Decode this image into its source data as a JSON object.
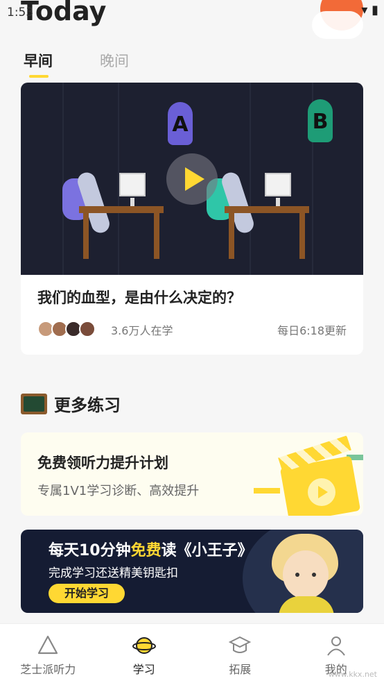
{
  "status": {
    "time": "1:53"
  },
  "header": {
    "title": "Today"
  },
  "tabs": [
    {
      "label": "早间",
      "active": true
    },
    {
      "label": "晚间",
      "active": false
    }
  ],
  "video": {
    "letter_a": "A",
    "letter_b": "B",
    "title": "我们的血型，是由什么决定的？",
    "learners": "3.6万人在学",
    "update": "每日6:18更新"
  },
  "section": {
    "title": "更多练习"
  },
  "promo": {
    "title": "免费领听力提升计划",
    "subtitle": "专属1V1学习诊断、高效提升"
  },
  "banner": {
    "title_prefix": "每天10分钟",
    "title_highlight": "免费",
    "title_suffix": "读《小王子》",
    "subtitle": "完成学习还送精美钥匙扣",
    "button": "开始学习"
  },
  "tabbar": [
    {
      "label": "芝士派听力",
      "icon": "cheese-icon"
    },
    {
      "label": "学习",
      "icon": "planet-icon",
      "active": true
    },
    {
      "label": "拓展",
      "icon": "graduation-cap-icon"
    },
    {
      "label": "我的",
      "icon": "person-icon"
    }
  ],
  "watermark": "www.kkx.net",
  "colors": {
    "accent": "#ffd833",
    "background": "#f6f6f6",
    "banner": "#151c33"
  }
}
